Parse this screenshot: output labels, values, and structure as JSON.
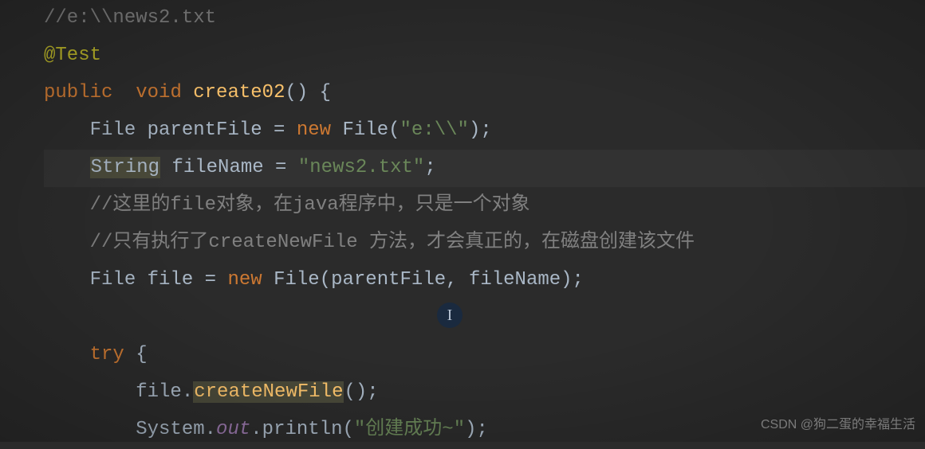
{
  "code": {
    "line1_comment": "//e:\\\\news2.txt",
    "line2_annotation": "@Test",
    "line3_public": "public",
    "line3_void": "void",
    "line3_method": "create02",
    "line3_paren_open": "()",
    "line3_brace": " {",
    "line4_type": "File",
    "line4_var": "parentFile",
    "line4_eq": " = ",
    "line4_new": "new",
    "line4_ctor": " File(",
    "line4_str": "\"e:\\\\\"",
    "line4_end": ");",
    "line5_type": "String",
    "line5_var": "fileName",
    "line5_eq": " = ",
    "line5_str": "\"news2.txt\"",
    "line5_end": ";",
    "line6_comment": "//这里的file对象，在java程序中，只是一个对象",
    "line7_comment": "//只有执行了createNewFile 方法，才会真正的，在磁盘创建该文件",
    "line8_type": "File",
    "line8_var": "file",
    "line8_eq": " = ",
    "line8_new": "new",
    "line8_ctor": " File(",
    "line8_arg1": "parentFile",
    "line8_comma": ", ",
    "line8_arg2": "fileName",
    "line8_end": ");",
    "line10_try": "try",
    "line10_brace": " {",
    "line11_obj": "file.",
    "line11_method": "createNewFile",
    "line11_end": "();",
    "line12_class": "System.",
    "line12_out": "out",
    "line12_print": ".println(",
    "line12_str": "\"创建成功~\"",
    "line12_end": ");"
  },
  "watermark": "CSDN @狗二蛋的幸福生活",
  "cursor_glyph": "I"
}
